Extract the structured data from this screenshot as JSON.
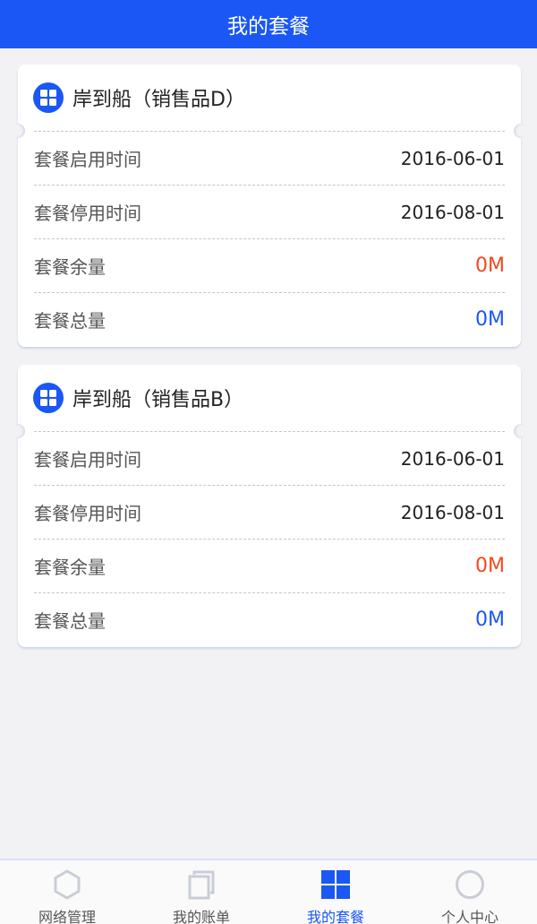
{
  "header": {
    "title": "我的套餐"
  },
  "packages": [
    {
      "name": "岸到船（销售品D）",
      "rows": [
        {
          "label": "套餐启用时间",
          "value": "2016-06-01"
        },
        {
          "label": "套餐停用时间",
          "value": "2016-08-01"
        },
        {
          "label": "套餐余量",
          "value": "0M"
        },
        {
          "label": "套餐总量",
          "value": "0M"
        }
      ]
    },
    {
      "name": "岸到船（销售品B）",
      "rows": [
        {
          "label": "套餐启用时间",
          "value": "2016-06-01"
        },
        {
          "label": "套餐停用时间",
          "value": "2016-08-01"
        },
        {
          "label": "套餐余量",
          "value": "0M"
        },
        {
          "label": "套餐总量",
          "value": "0M"
        }
      ]
    }
  ],
  "tabbar": {
    "items": [
      {
        "label": "网络管理",
        "icon": "hexagon-icon"
      },
      {
        "label": "我的账单",
        "icon": "document-icon"
      },
      {
        "label": "我的套餐",
        "icon": "grid-icon",
        "active": true
      },
      {
        "label": "个人中心",
        "icon": "circle-user-icon"
      }
    ]
  },
  "colors": {
    "accent": "#1a57f5",
    "remaining": "#f04a1f",
    "background": "#f2f2f4"
  }
}
